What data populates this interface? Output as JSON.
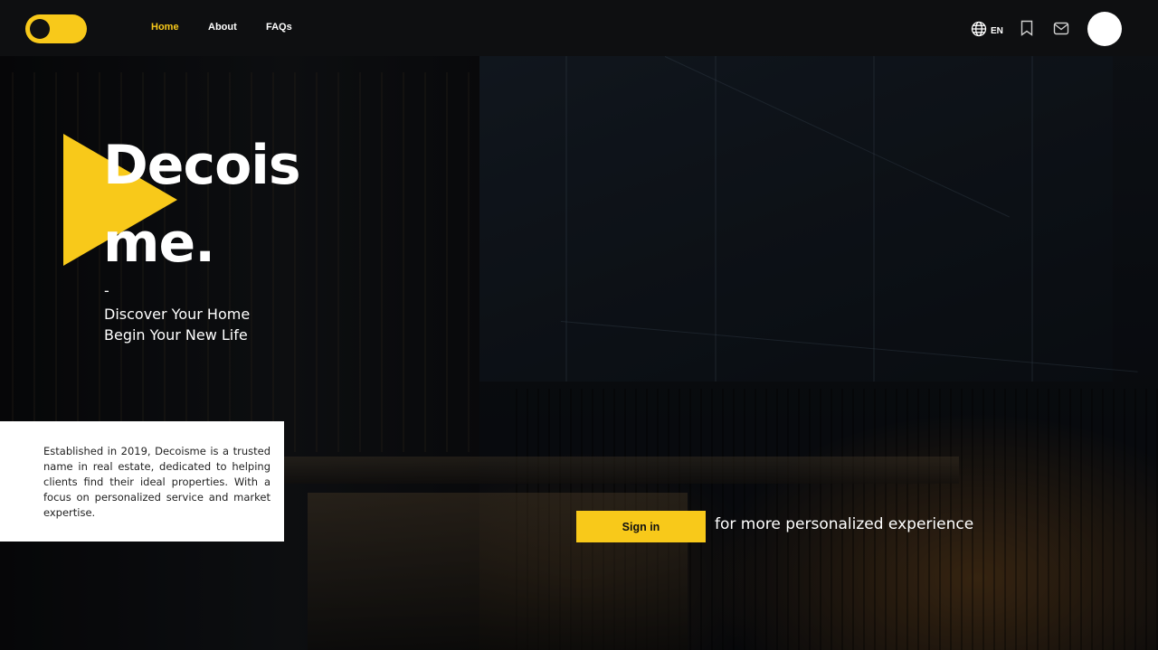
{
  "nav": {
    "items": [
      {
        "label": "Home",
        "active": true
      },
      {
        "label": "About",
        "active": false
      },
      {
        "label": "FAQs",
        "active": false
      }
    ]
  },
  "header": {
    "language": "EN",
    "icons": [
      "globe-icon",
      "bookmark-icon",
      "mail-icon"
    ]
  },
  "hero": {
    "title_line1": "Decois",
    "title_line2": "me.",
    "dash": "-",
    "subtitle_line1": "Discover Your Home",
    "subtitle_line2": "Begin Your New Life"
  },
  "about": {
    "text": "Established in 2019, Decoisme is a trusted name in real estate, dedicated to helping clients find their ideal properties. With a focus on personalized service and market expertise."
  },
  "cta": {
    "button_label": "Sign in",
    "note": "for more personalized experience"
  },
  "colors": {
    "accent": "#f8c91a",
    "header_bg": "#0e0f11",
    "card_bg": "#ffffff"
  }
}
